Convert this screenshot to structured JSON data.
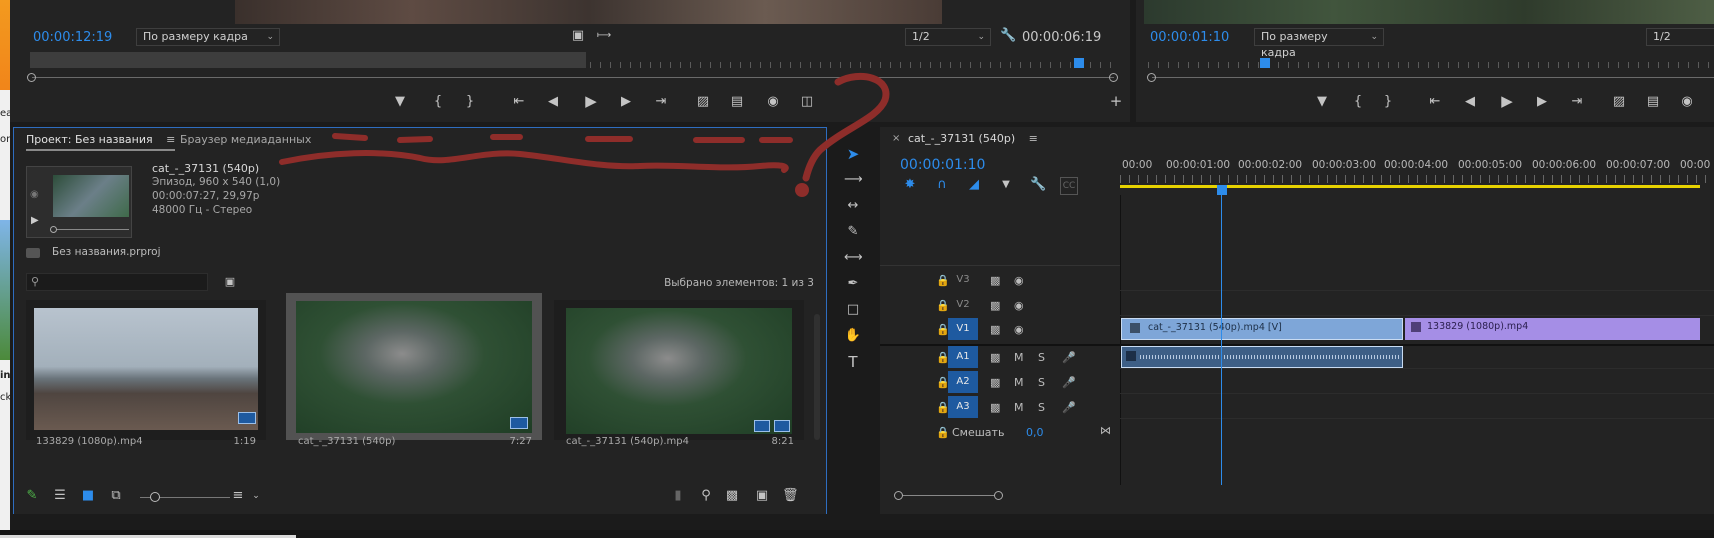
{
  "source_monitor": {
    "timecode": "00:00:12:19",
    "fit_dropdown": "По размеру кадра",
    "resolution": "1/2",
    "duration": "00:00:06:19"
  },
  "program_monitor": {
    "timecode": "00:00:01:10",
    "fit_dropdown": "По размеру кадра",
    "resolution": "1/2"
  },
  "project_panel": {
    "tab_project": "Проект: Без названия",
    "tab_media_browser": "Браузер медиаданных",
    "clip_name": "cat_-_37131 (540p)",
    "clip_info_1": "Эпизод, 960 x 540 (1,0)",
    "clip_info_2": "00:00:07:27, 29,97р",
    "clip_info_3": "48000 Гц - Стерео",
    "project_file": "Без названия.prproj",
    "search_placeholder": "",
    "selected_count": "Выбрано элементов: 1 из 3",
    "items": [
      {
        "label": "133829 (1080p).mp4",
        "duration": "1:19"
      },
      {
        "label": "cat_-_37131 (540p)",
        "duration": "7:27"
      },
      {
        "label": "cat_-_37131 (540p).mp4",
        "duration": "8:21"
      }
    ]
  },
  "timeline": {
    "sequence_tab": "cat_-_37131 (540p)",
    "timecode": "00:00:01:10",
    "ruler": [
      "00:00",
      "00:00:01:00",
      "00:00:02:00",
      "00:00:03:00",
      "00:00:04:00",
      "00:00:05:00",
      "00:00:06:00",
      "00:00:07:00",
      "00:00"
    ],
    "tracks_video": [
      "V3",
      "V2",
      "V1"
    ],
    "tracks_audio": [
      "A1",
      "A2",
      "A3"
    ],
    "mute_label": "M",
    "solo_label": "S",
    "mix_label": "Смешать",
    "mix_value": "0,0",
    "clip_v1_a": "cat_-_37131 (540p).mp4 [V]",
    "clip_v1_b": "133829 (1080p).mp4"
  },
  "left_edge_fragments": [
    "ea",
    "or",
    "in",
    "ck"
  ],
  "colors": {
    "accent_blue": "#2d8ceb",
    "clip_blue": "#7ea6d8",
    "clip_purple": "#a58ee6",
    "annotation_red": "#8e2d2a",
    "work_area_yellow": "#e6d200"
  }
}
